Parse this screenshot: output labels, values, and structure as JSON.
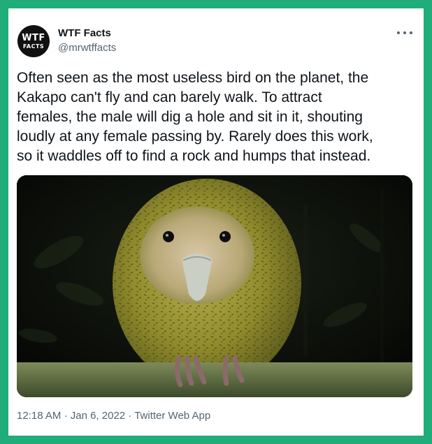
{
  "author": {
    "avatar_line1": "WTF",
    "avatar_line2": "FACTS",
    "name": "WTF Facts",
    "handle": "@mrwtffacts"
  },
  "tweet": {
    "text": "Often seen as the most useless bird on the planet, the\nKakapo can't fly and can barely walk. To attract\nfemales, the male will dig a hole and sit in it, shouting\nloudly at any female passing by. Rarely does this work,\nso it waddles off to find a rock and humps that instead.",
    "time": "12:18 AM",
    "separator": "·",
    "date": "Jan 6, 2022",
    "source": "Twitter Web App"
  },
  "icons": {
    "more": "more-horizontal-icon"
  },
  "colors": {
    "frame": "#1fad7a",
    "text": "#0f1419",
    "secondary": "#536471"
  }
}
